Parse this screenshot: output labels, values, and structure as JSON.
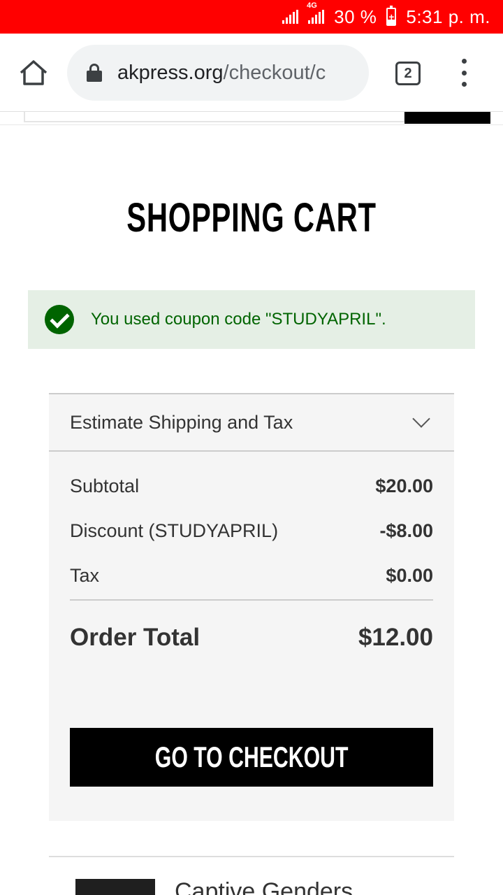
{
  "status_bar": {
    "network_label": "4G",
    "battery_percent": "30 %",
    "battery_level": 0.3,
    "time": "5:31 p. m.",
    "color": "#ff0000"
  },
  "browser": {
    "url_domain": "akpress.org",
    "url_path": "/checkout/c",
    "tab_count": "2",
    "icons": [
      "home-icon",
      "lock-icon",
      "tabs-icon",
      "more-vert-icon"
    ]
  },
  "page": {
    "title": "SHOPPING CART",
    "alert": {
      "message": "You used coupon code \"STUDYAPRIL\".",
      "icon": "check-circle-icon",
      "color": "#006400"
    },
    "summary": {
      "estimate_label": "Estimate Shipping and Tax",
      "rows": [
        {
          "label": "Subtotal",
          "value": "$20.00"
        },
        {
          "label": "Discount (STUDYAPRIL)",
          "value": "-$8.00"
        },
        {
          "label": "Tax",
          "value": "$0.00"
        }
      ],
      "total_label": "Order Total",
      "total_value": "$12.00",
      "checkout_label": "GO TO CHECKOUT"
    },
    "product": {
      "title": "Captive Genders"
    }
  }
}
